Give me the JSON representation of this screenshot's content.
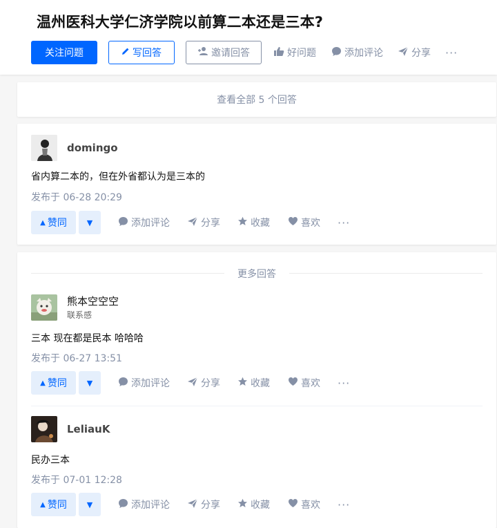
{
  "question": {
    "title": "温州医科大学仁济学院以前算二本还是三本?"
  },
  "header_actions": {
    "follow": "关注问题",
    "write": "写回答",
    "invite": "邀请回答",
    "good_question": "好问题",
    "add_comment": "添加评论",
    "share": "分享",
    "more": "···"
  },
  "view_all": "查看全部 5 个回答",
  "more_answers_label": "更多回答",
  "answer_actions": {
    "upvote": "赞同",
    "comment": "添加评论",
    "share": "分享",
    "collect": "收藏",
    "like": "喜欢",
    "more": "···"
  },
  "answers": [
    {
      "author": "domingo",
      "headline": "",
      "content": "省内算二本的，但在外省都认为是三本的",
      "time": "发布于 06-28 20:29"
    },
    {
      "author": "熊本空空空",
      "headline": "联系感",
      "content": "三本 现在都是民本 哈哈哈",
      "time": "发布于 06-27 13:51"
    },
    {
      "author": "LeliauK",
      "headline": "",
      "content": "民办三本",
      "time": "发布于 07-01 12:28"
    }
  ],
  "colors": {
    "brand_blue": "#0066ff",
    "muted_gray": "#8590a6",
    "vote_bg": "#e5effc",
    "page_bg": "#f6f6f6"
  },
  "icons": [
    "pencil-icon",
    "add-person-icon",
    "thumb-up-icon",
    "comment-icon",
    "share-icon",
    "star-icon",
    "heart-icon",
    "more-icon",
    "triangle-up-icon",
    "triangle-down-icon"
  ]
}
